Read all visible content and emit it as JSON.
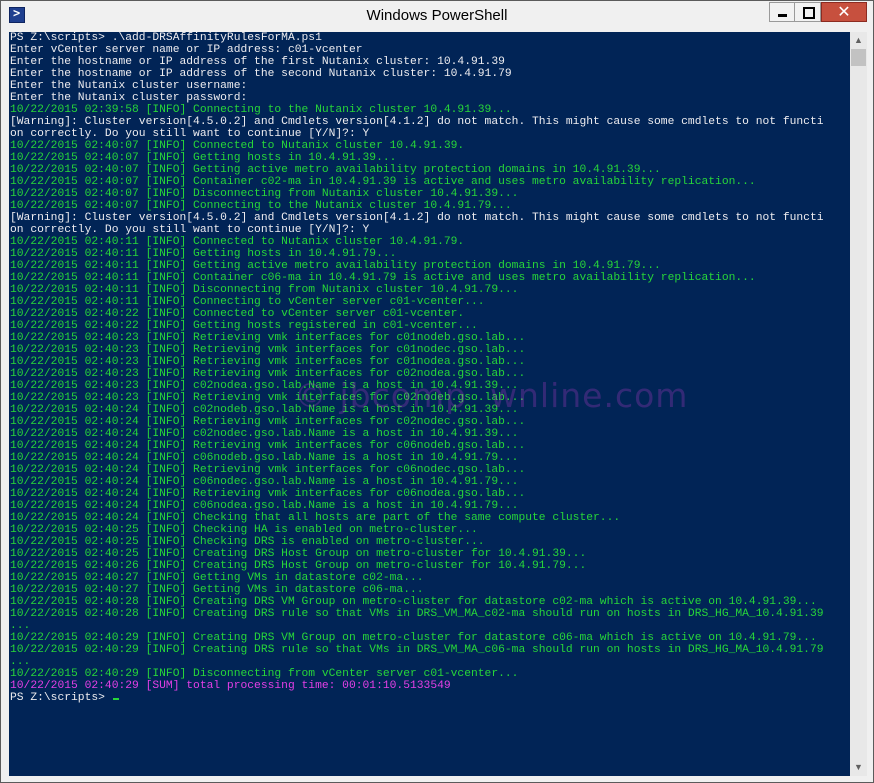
{
  "window": {
    "title": "Windows PowerShell",
    "icon": "powershell-icon",
    "controls": {
      "minimize": "minimize-icon",
      "maximize": "maximize-icon",
      "close": "close-icon",
      "close_glyph": "✕"
    }
  },
  "colors": {
    "console_bg": "#012456",
    "default_text": "#eeedf0",
    "info_text": "#27d639",
    "sum_text": "#e43fe6",
    "close_button": "#c7503e"
  },
  "watermark": "© jbcomp  wnline.com",
  "scrollbar": {
    "up_glyph": "▲",
    "down_glyph": "▼"
  },
  "console": {
    "prompt": "PS Z:\\scripts> ",
    "lines": [
      {
        "type": "plain",
        "text": "PS Z:\\scripts> .\\add-DRSAffinityRulesForMA.ps1"
      },
      {
        "type": "plain",
        "text": "Enter vCenter server name or IP address: c01-vcenter"
      },
      {
        "type": "plain",
        "text": "Enter the hostname or IP address of the first Nutanix cluster: 10.4.91.39"
      },
      {
        "type": "plain",
        "text": "Enter the hostname or IP address of the second Nutanix cluster: 10.4.91.79"
      },
      {
        "type": "plain",
        "text": "Enter the Nutanix cluster username:"
      },
      {
        "type": "plain",
        "text": "Enter the Nutanix cluster password:"
      },
      {
        "type": "info",
        "text": "10/22/2015 02:39:58 [INFO] Connecting to the Nutanix cluster 10.4.91.39..."
      },
      {
        "type": "plain",
        "text": "[Warning]: Cluster version[4.5.0.2] and Cmdlets version[4.1.2] do not match. This might cause some cmdlets to not functi"
      },
      {
        "type": "plain",
        "text": "on correctly. Do you still want to continue [Y/N]?: Y"
      },
      {
        "type": "info",
        "text": "10/22/2015 02:40:07 [INFO] Connected to Nutanix cluster 10.4.91.39."
      },
      {
        "type": "info",
        "text": "10/22/2015 02:40:07 [INFO] Getting hosts in 10.4.91.39..."
      },
      {
        "type": "info",
        "text": "10/22/2015 02:40:07 [INFO] Getting active metro availability protection domains in 10.4.91.39..."
      },
      {
        "type": "info",
        "text": "10/22/2015 02:40:07 [INFO] Container c02-ma in 10.4.91.39 is active and uses metro availability replication..."
      },
      {
        "type": "info",
        "text": "10/22/2015 02:40:07 [INFO] Disconnecting from Nutanix cluster 10.4.91.39..."
      },
      {
        "type": "info",
        "text": "10/22/2015 02:40:07 [INFO] Connecting to the Nutanix cluster 10.4.91.79..."
      },
      {
        "type": "plain",
        "text": "[Warning]: Cluster version[4.5.0.2] and Cmdlets version[4.1.2] do not match. This might cause some cmdlets to not functi"
      },
      {
        "type": "plain",
        "text": "on correctly. Do you still want to continue [Y/N]?: Y"
      },
      {
        "type": "info",
        "text": "10/22/2015 02:40:11 [INFO] Connected to Nutanix cluster 10.4.91.79."
      },
      {
        "type": "info",
        "text": "10/22/2015 02:40:11 [INFO] Getting hosts in 10.4.91.79..."
      },
      {
        "type": "info",
        "text": "10/22/2015 02:40:11 [INFO] Getting active metro availability protection domains in 10.4.91.79..."
      },
      {
        "type": "info",
        "text": "10/22/2015 02:40:11 [INFO] Container c06-ma in 10.4.91.79 is active and uses metro availability replication..."
      },
      {
        "type": "info",
        "text": "10/22/2015 02:40:11 [INFO] Disconnecting from Nutanix cluster 10.4.91.79..."
      },
      {
        "type": "info",
        "text": "10/22/2015 02:40:11 [INFO] Connecting to vCenter server c01-vcenter..."
      },
      {
        "type": "info",
        "text": "10/22/2015 02:40:22 [INFO] Connected to vCenter server c01-vcenter."
      },
      {
        "type": "info",
        "text": "10/22/2015 02:40:22 [INFO] Getting hosts registered in c01-vcenter..."
      },
      {
        "type": "info",
        "text": "10/22/2015 02:40:23 [INFO] Retrieving vmk interfaces for c01nodeb.gso.lab..."
      },
      {
        "type": "info",
        "text": "10/22/2015 02:40:23 [INFO] Retrieving vmk interfaces for c01nodec.gso.lab..."
      },
      {
        "type": "info",
        "text": "10/22/2015 02:40:23 [INFO] Retrieving vmk interfaces for c01nodea.gso.lab..."
      },
      {
        "type": "info",
        "text": "10/22/2015 02:40:23 [INFO] Retrieving vmk interfaces for c02nodea.gso.lab..."
      },
      {
        "type": "info",
        "text": "10/22/2015 02:40:23 [INFO] c02nodea.gso.lab.Name is a host in 10.4.91.39..."
      },
      {
        "type": "info",
        "text": "10/22/2015 02:40:23 [INFO] Retrieving vmk interfaces for c02nodeb.gso.lab..."
      },
      {
        "type": "info",
        "text": "10/22/2015 02:40:24 [INFO] c02nodeb.gso.lab.Name is a host in 10.4.91.39..."
      },
      {
        "type": "info",
        "text": "10/22/2015 02:40:24 [INFO] Retrieving vmk interfaces for c02nodec.gso.lab..."
      },
      {
        "type": "info",
        "text": "10/22/2015 02:40:24 [INFO] c02nodec.gso.lab.Name is a host in 10.4.91.39..."
      },
      {
        "type": "info",
        "text": "10/22/2015 02:40:24 [INFO] Retrieving vmk interfaces for c06nodeb.gso.lab..."
      },
      {
        "type": "info",
        "text": "10/22/2015 02:40:24 [INFO] c06nodeb.gso.lab.Name is a host in 10.4.91.79..."
      },
      {
        "type": "info",
        "text": "10/22/2015 02:40:24 [INFO] Retrieving vmk interfaces for c06nodec.gso.lab..."
      },
      {
        "type": "info",
        "text": "10/22/2015 02:40:24 [INFO] c06nodec.gso.lab.Name is a host in 10.4.91.79..."
      },
      {
        "type": "info",
        "text": "10/22/2015 02:40:24 [INFO] Retrieving vmk interfaces for c06nodea.gso.lab..."
      },
      {
        "type": "info",
        "text": "10/22/2015 02:40:24 [INFO] c06nodea.gso.lab.Name is a host in 10.4.91.79..."
      },
      {
        "type": "info",
        "text": "10/22/2015 02:40:24 [INFO] Checking that all hosts are part of the same compute cluster..."
      },
      {
        "type": "info",
        "text": "10/22/2015 02:40:25 [INFO] Checking HA is enabled on metro-cluster..."
      },
      {
        "type": "info",
        "text": "10/22/2015 02:40:25 [INFO] Checking DRS is enabled on metro-cluster..."
      },
      {
        "type": "info",
        "text": "10/22/2015 02:40:25 [INFO] Creating DRS Host Group on metro-cluster for 10.4.91.39..."
      },
      {
        "type": "info",
        "text": "10/22/2015 02:40:26 [INFO] Creating DRS Host Group on metro-cluster for 10.4.91.79..."
      },
      {
        "type": "info",
        "text": "10/22/2015 02:40:27 [INFO] Getting VMs in datastore c02-ma..."
      },
      {
        "type": "info",
        "text": "10/22/2015 02:40:27 [INFO] Getting VMs in datastore c06-ma..."
      },
      {
        "type": "info",
        "text": "10/22/2015 02:40:28 [INFO] Creating DRS VM Group on metro-cluster for datastore c02-ma which is active on 10.4.91.39..."
      },
      {
        "type": "info",
        "text": "10/22/2015 02:40:28 [INFO] Creating DRS rule so that VMs in DRS_VM_MA_c02-ma should run on hosts in DRS_HG_MA_10.4.91.39"
      },
      {
        "type": "info",
        "text": "..."
      },
      {
        "type": "info",
        "text": "10/22/2015 02:40:29 [INFO] Creating DRS VM Group on metro-cluster for datastore c06-ma which is active on 10.4.91.79..."
      },
      {
        "type": "info",
        "text": "10/22/2015 02:40:29 [INFO] Creating DRS rule so that VMs in DRS_VM_MA_c06-ma should run on hosts in DRS_HG_MA_10.4.91.79"
      },
      {
        "type": "info",
        "text": "..."
      },
      {
        "type": "info",
        "text": "10/22/2015 02:40:29 [INFO] Disconnecting from vCenter server c01-vcenter..."
      },
      {
        "type": "sum",
        "text": "10/22/2015 02:40:29 [SUM] total processing time: 00:01:10.5133549"
      }
    ]
  }
}
